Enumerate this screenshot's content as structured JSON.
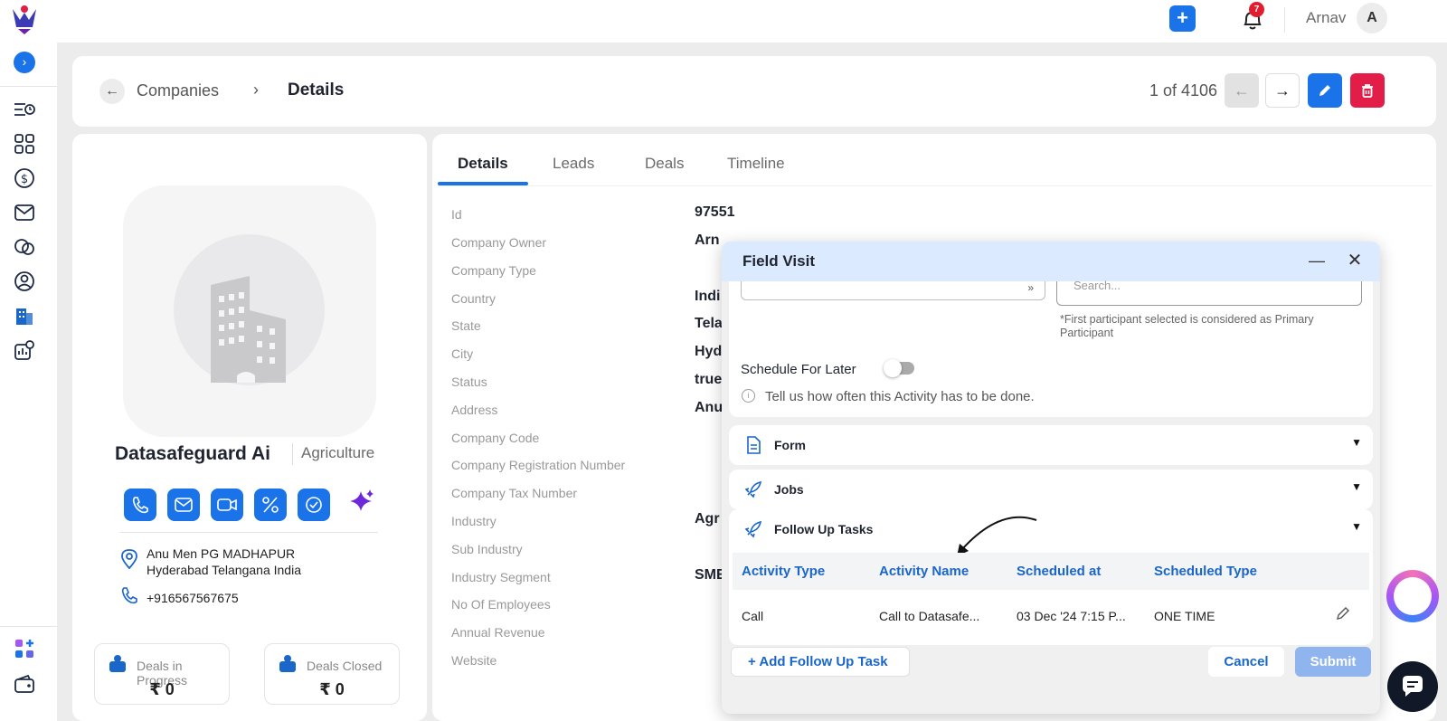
{
  "topbar": {
    "add_label": "+",
    "notifications_count": "7",
    "user_name": "Arnav",
    "user_initial": "A"
  },
  "sidebar": {
    "toggle": "›",
    "items": [
      "activity-icon",
      "grid-icon",
      "dollar-icon",
      "mail-icon",
      "chat-icon",
      "contact-icon",
      "companies-icon",
      "settings-icon",
      "apps-icon",
      "wallet-icon"
    ]
  },
  "breadcrumb": {
    "back": "←",
    "parent": "Companies",
    "separator": "›",
    "current": "Details",
    "pager": "1 of 4106",
    "prev": "←",
    "next": "→"
  },
  "company": {
    "name": "Datasafeguard Ai",
    "industry": "Agriculture",
    "address_line1": "Anu Men PG MADHAPUR",
    "address_line2": "Hyderabad Telangana India",
    "phone": "+916567567675",
    "stats": [
      {
        "label": "Deals in Progress",
        "value": "₹ 0"
      },
      {
        "label": "Deals Closed",
        "value": "₹ 0"
      }
    ]
  },
  "tabs": [
    "Details",
    "Leads",
    "Deals",
    "Timeline"
  ],
  "details": {
    "labels": [
      "Id",
      "Company Owner",
      "Company Type",
      "Country",
      "State",
      "City",
      "Status",
      "Address",
      "Company Code",
      "Company Registration Number",
      "Company Tax Number",
      "Industry",
      "Sub Industry",
      "Industry Segment",
      "No Of Employees",
      "Annual Revenue",
      "Website"
    ],
    "values": {
      "id": "97551",
      "owner": "Arn",
      "country": "Indi",
      "state": "Tela",
      "city": "Hyd",
      "status": "true",
      "address": "Anu",
      "industry": "Agr",
      "segment": "SME"
    }
  },
  "modal": {
    "title": "Field Visit",
    "minimize": "—",
    "close": "✕",
    "search_placeholder": "Search...",
    "left_input_chev": "»",
    "participant_note": "*First participant selected is considered as Primary Participant",
    "schedule_label": "Schedule For Later",
    "info_text": "Tell us how often this Activity has to be done.",
    "sections": [
      {
        "label": "Form",
        "icon": "form-icon"
      },
      {
        "label": "Jobs",
        "icon": "rocket-icon"
      },
      {
        "label": "Follow Up Tasks",
        "icon": "rocket-icon"
      }
    ],
    "caret": "▼",
    "followup": {
      "headers": [
        "Activity Type",
        "Activity Name",
        "Scheduled at",
        "Scheduled Type"
      ],
      "rows": [
        {
          "type": "Call",
          "name": "Call to Datasafe...",
          "scheduled_at": "03 Dec '24 7:15 P...",
          "scheduled_type": "ONE TIME"
        }
      ]
    },
    "add_followup": "+ Add Follow Up Task",
    "cancel": "Cancel",
    "submit": "Submit"
  },
  "colors": {
    "accent": "#1a73e8",
    "danger": "#e11d48",
    "header_blue": "#dbeafe",
    "link_blue": "#1a66c9"
  }
}
